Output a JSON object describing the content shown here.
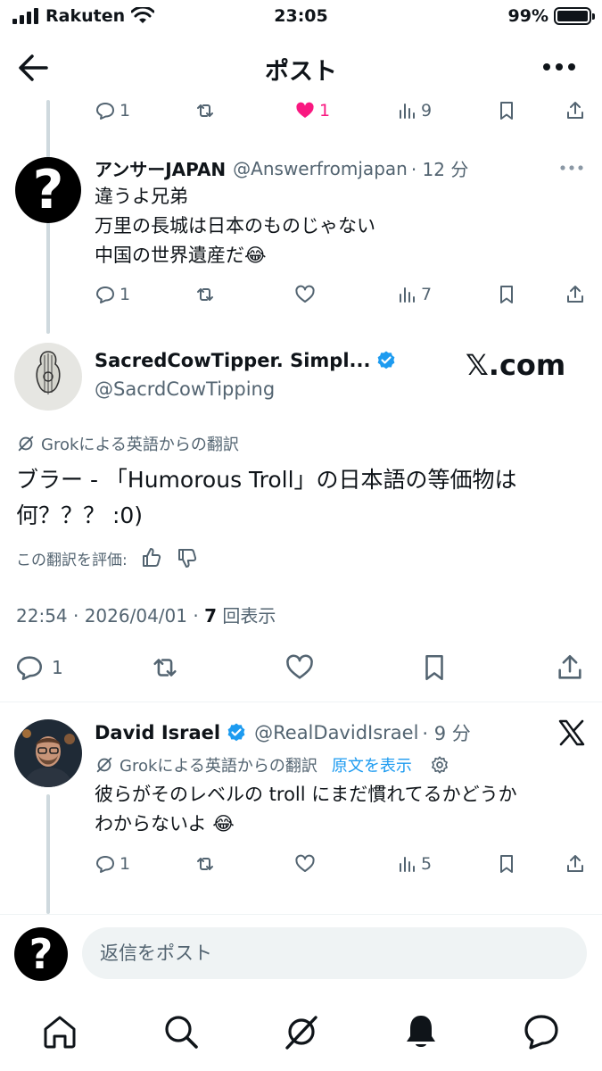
{
  "status": {
    "carrier": "Rakuten",
    "time": "23:05",
    "battery": "99%",
    "battery_level": 0.99
  },
  "header": {
    "title": "ポスト"
  },
  "prev_actions": {
    "reply": "1",
    "like": "1",
    "views": "9"
  },
  "reply1": {
    "name": "アンサーJAPAN",
    "handle": "@Answerfromjapan",
    "time": "· 12 分",
    "lines": [
      "違うよ兄弟",
      "万里の長城は日本のものじゃない",
      "中国の世界遺産だ😂"
    ],
    "reply_count": "1",
    "views": "7"
  },
  "main": {
    "name": "SacredCowTipper. Simpl...",
    "handle": "@SacrdCowTipping",
    "watermark": "𝕏.com",
    "grok_label": "Grokによる英語からの翻訳",
    "text_line1": "ブラー - 「Humorous Troll」の日本語の等価物は",
    "text_line2": "何？？？ :0)",
    "rate_label": "この翻訳を評価:",
    "datetime": "22:54 · 2026/04/01 · ",
    "views_num": "7",
    "views_label": " 回表示",
    "reply_count": "1"
  },
  "reply2": {
    "name": "David Israel",
    "handle": "@RealDavidIsrael",
    "time": "· 9 分",
    "grok_label": "Grokによる英語からの翻訳",
    "show_original": "原文を表示",
    "line1": "彼らがそのレベルの troll にまだ慣れてるかどうか",
    "line2": "わからないよ 😂",
    "reply_count": "1",
    "views": "5"
  },
  "reply_bar": {
    "placeholder": "返信をポスト"
  },
  "colors": {
    "accent": "#1d9bf0",
    "like": "#f91880",
    "muted": "#536471",
    "text": "#0f1419"
  },
  "icons": [
    "back-arrow-icon",
    "more-icon",
    "reply-icon",
    "repost-icon",
    "like-icon",
    "views-icon",
    "bookmark-icon",
    "share-icon",
    "verified-icon",
    "grok-icon",
    "x-logo-icon",
    "home-icon",
    "search-icon",
    "notifications-icon",
    "messages-icon"
  ]
}
